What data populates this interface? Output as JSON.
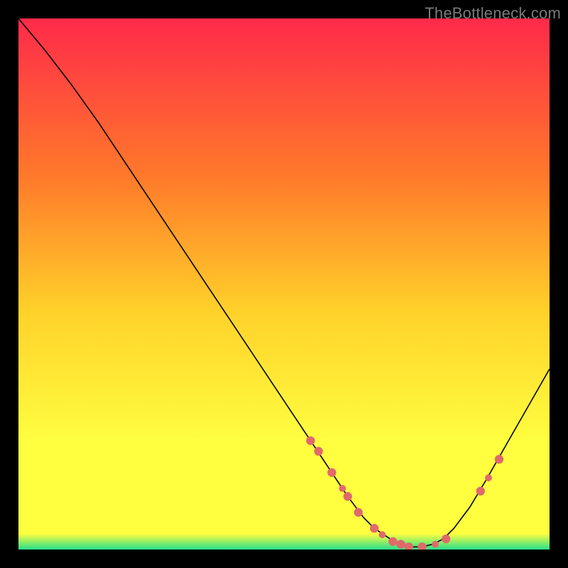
{
  "watermark": "TheBottleneck.com",
  "colors": {
    "background": "#000000",
    "gradient_top": "#ff2a4a",
    "gradient_mid1": "#ff7a2a",
    "gradient_mid2": "#ffd12a",
    "gradient_mid3": "#ffff40",
    "gradient_bottom": "#28e08a",
    "curve": "#000000",
    "marker": "#e06a6a"
  },
  "chart_data": {
    "type": "line",
    "title": "",
    "xlabel": "",
    "ylabel": "",
    "xlim": [
      0,
      100
    ],
    "ylim": [
      0,
      100
    ],
    "grid": false,
    "series": [
      {
        "name": "bottleneck_curve",
        "x": [
          0,
          5,
          10,
          15,
          20,
          25,
          30,
          35,
          40,
          45,
          50,
          55,
          60,
          62,
          65,
          67,
          70,
          72,
          73,
          74,
          76,
          78,
          80,
          82,
          85,
          88,
          92,
          96,
          100
        ],
        "y": [
          100,
          94,
          87.5,
          80.5,
          73,
          65.5,
          58,
          50.5,
          43,
          35.5,
          28,
          20.5,
          13,
          10,
          6,
          4,
          2,
          1,
          0.5,
          0.5,
          0.5,
          1,
          2,
          4,
          8,
          13,
          20,
          27,
          34
        ]
      }
    ],
    "markers": [
      {
        "x": 55,
        "y": 20.5,
        "r": 1.5
      },
      {
        "x": 56.5,
        "y": 18.5,
        "r": 1.5
      },
      {
        "x": 59,
        "y": 14.5,
        "r": 1.5
      },
      {
        "x": 61,
        "y": 11.5,
        "r": 1.2
      },
      {
        "x": 62,
        "y": 10,
        "r": 1.5
      },
      {
        "x": 64,
        "y": 7,
        "r": 1.5
      },
      {
        "x": 67,
        "y": 4,
        "r": 1.5
      },
      {
        "x": 68.5,
        "y": 2.8,
        "r": 1.2
      },
      {
        "x": 70.5,
        "y": 1.5,
        "r": 1.5
      },
      {
        "x": 72,
        "y": 1,
        "r": 1.5
      },
      {
        "x": 73.5,
        "y": 0.5,
        "r": 1.5
      },
      {
        "x": 76,
        "y": 0.5,
        "r": 1.5
      },
      {
        "x": 78.5,
        "y": 1,
        "r": 1.2
      },
      {
        "x": 80.5,
        "y": 2,
        "r": 1.5
      },
      {
        "x": 87,
        "y": 11,
        "r": 1.5
      },
      {
        "x": 88.5,
        "y": 13.5,
        "r": 1.2
      },
      {
        "x": 90.5,
        "y": 17,
        "r": 1.5
      }
    ]
  }
}
